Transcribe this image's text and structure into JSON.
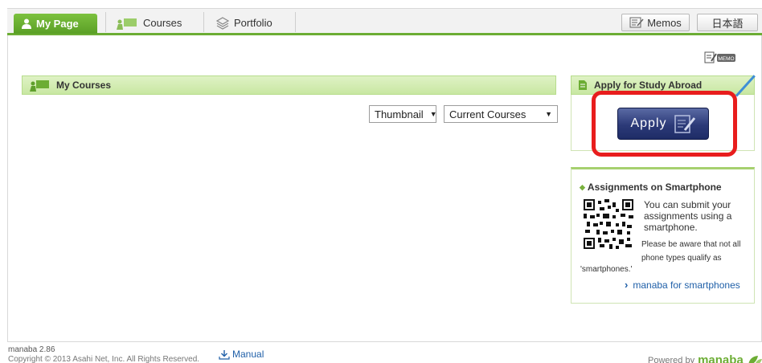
{
  "nav": {
    "tabs": [
      {
        "label": "My Page",
        "icon": "person-icon",
        "active": true
      },
      {
        "label": "Courses",
        "icon": "courses-icon",
        "active": false
      },
      {
        "label": "Portfolio",
        "icon": "portfolio-icon",
        "active": false
      }
    ],
    "memos_label": "Memos",
    "language_label": "日本語"
  },
  "memo_corner_label": "MEMO",
  "my_courses": {
    "title": "My Courses",
    "view_select": "Thumbnail",
    "filter_select": "Current Courses"
  },
  "study_abroad": {
    "title": "Apply for Study Abroad",
    "apply_label": "Apply"
  },
  "smartphone": {
    "title": "Assignments on Smartphone",
    "text": "You can submit your assignments using a smartphone.",
    "note": "Please be aware that not all phone types qualify as",
    "note_tail": "'smartphones.'",
    "link_label": "manaba for smartphones"
  },
  "footer": {
    "version": "manaba 2.86",
    "copyright": "Copyright © 2013 Asahi Net, Inc. All Rights Reserved.",
    "manual_label": "Manual",
    "powered_by": "Powered by",
    "brand": "manaba"
  },
  "colors": {
    "accent_green": "#6cad34",
    "highlight_red": "#e81d1d",
    "apply_navy": "#2c3a78",
    "link_blue": "#1f5fa8"
  }
}
